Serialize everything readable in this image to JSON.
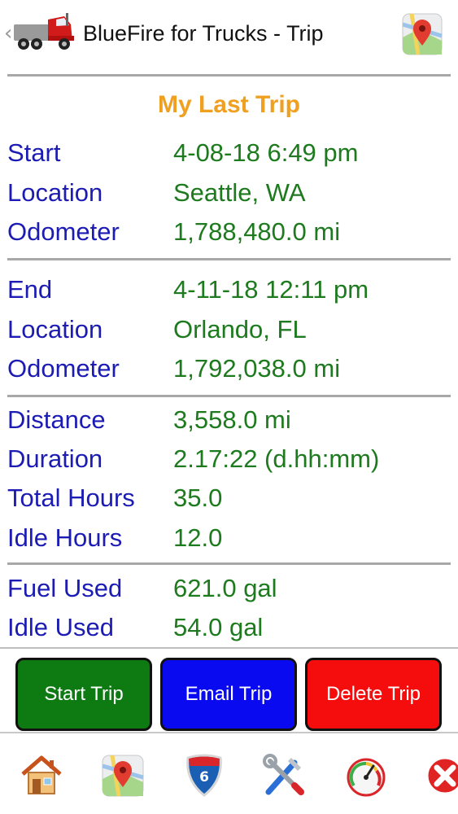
{
  "header": {
    "back_glyph": "‹",
    "title": "BlueFire for Trucks - Trip",
    "truck_icon": "truck-icon",
    "map_icon": "map-pin-icon"
  },
  "trip": {
    "section_title": "My Last Trip",
    "start": [
      {
        "label": "Start",
        "value": "4-08-18 6:49 pm"
      },
      {
        "label": "Location",
        "value": "Seattle, WA"
      },
      {
        "label": "Odometer",
        "value": "1,788,480.0 mi"
      }
    ],
    "end": [
      {
        "label": "End",
        "value": "4-11-18 12:11 pm"
      },
      {
        "label": "Location",
        "value": "Orlando, FL"
      },
      {
        "label": "Odometer",
        "value": "1,792,038.0 mi"
      }
    ],
    "stats": [
      {
        "label": "Distance",
        "value": "3,558.0 mi"
      },
      {
        "label": "Duration",
        "value": "2.17:22 (d.hh:mm)"
      },
      {
        "label": "Total Hours",
        "value": "35.0"
      },
      {
        "label": "Idle Hours",
        "value": "12.0"
      }
    ],
    "fuel": [
      {
        "label": "Fuel Used",
        "value": "621.0 gal"
      },
      {
        "label": "Idle Used",
        "value": "54.0 gal"
      }
    ]
  },
  "buttons": {
    "start": "Start Trip",
    "email": "Email Trip",
    "delete": "Delete Trip"
  },
  "nav": [
    {
      "icon": "home-icon"
    },
    {
      "icon": "map-pin-icon"
    },
    {
      "icon": "highway-shield-icon",
      "text": "6"
    },
    {
      "icon": "tools-icon"
    },
    {
      "icon": "gauge-icon"
    },
    {
      "icon": "close-icon"
    }
  ],
  "colors": {
    "label": "#1c1cb4",
    "value": "#1e7a1e",
    "title": "#f0a020",
    "start_btn": "#0d7a12",
    "email_btn": "#0a0af0",
    "delete_btn": "#f50d0d"
  }
}
